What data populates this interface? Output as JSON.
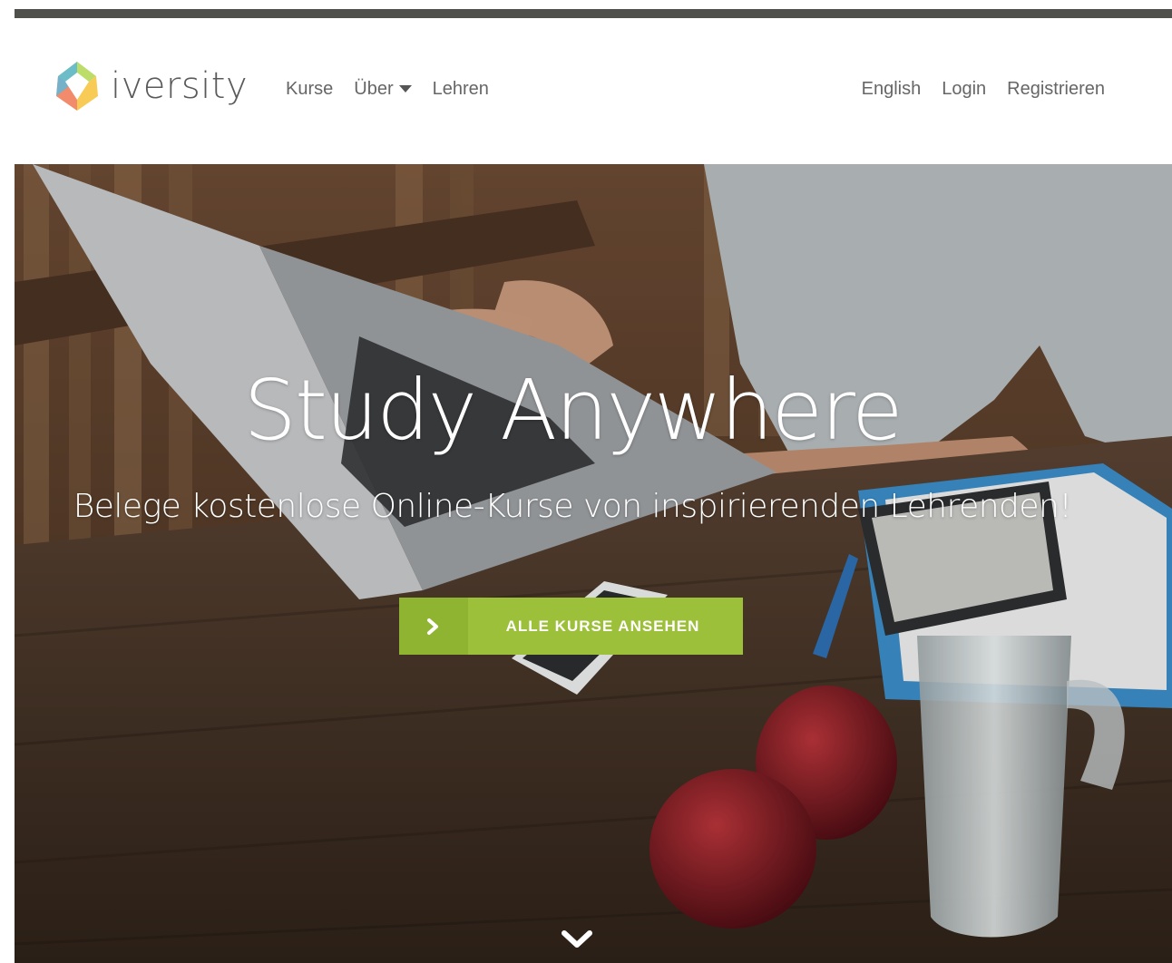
{
  "brand": {
    "name": "iversity",
    "logo_icon": "iversity-logo-icon"
  },
  "nav": {
    "left": [
      {
        "label": "Kurse"
      },
      {
        "label": "Über",
        "dropdown": true
      },
      {
        "label": "Lehren"
      }
    ],
    "right": [
      {
        "label": "English"
      },
      {
        "label": "Login"
      },
      {
        "label": "Registrieren"
      }
    ]
  },
  "hero": {
    "title": "Study Anywhere",
    "subtitle": "Belege kostenlose Online-Kurse von inspirierenden Lehrenden!",
    "cta_label": "ALLE KURSE ANSEHEN",
    "cta_icon": "chevron-right-icon",
    "scroll_icon": "chevron-down-icon"
  },
  "colors": {
    "top_bar": "#4f4f4b",
    "nav_text": "#666666",
    "cta_green": "#9cc03a",
    "cta_green_dark": "#8fb431",
    "hero_text": "#ffffff"
  }
}
